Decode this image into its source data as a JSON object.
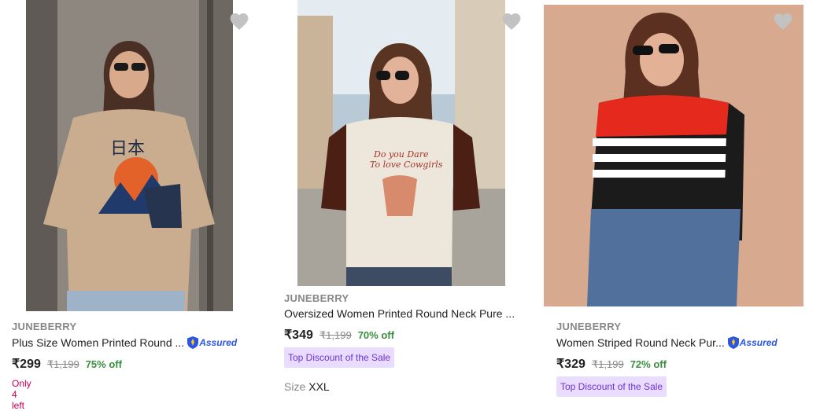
{
  "products": [
    {
      "brand": "JUNEBERRY",
      "title": "Plus Size Women Printed Round ...",
      "assured": "Assured",
      "price": "₹299",
      "mrp": "₹1,199",
      "discount": "75% off",
      "stock": "Only 4 left"
    },
    {
      "brand": "JUNEBERRY",
      "title": "Oversized Women Printed Round Neck Pure ...",
      "price": "₹349",
      "mrp": "₹1,199",
      "discount": "70% off",
      "badge": "Top Discount of the Sale",
      "size_label": "Size",
      "size_value": "XXL"
    },
    {
      "brand": "JUNEBERRY",
      "title": "Women Striped Round Neck Pur...",
      "assured": "Assured",
      "price": "₹329",
      "mrp": "₹1,199",
      "discount": "72% off",
      "badge": "Top Discount of the Sale"
    }
  ],
  "icons": {
    "wishlist": "heart-icon",
    "assured": "shield-icon"
  },
  "colors": {
    "discount": "#388e3c",
    "badge_bg": "#e9dcff",
    "badge_text": "#6d33d6",
    "stock": "#c70055",
    "assured": "#2a55e5"
  }
}
